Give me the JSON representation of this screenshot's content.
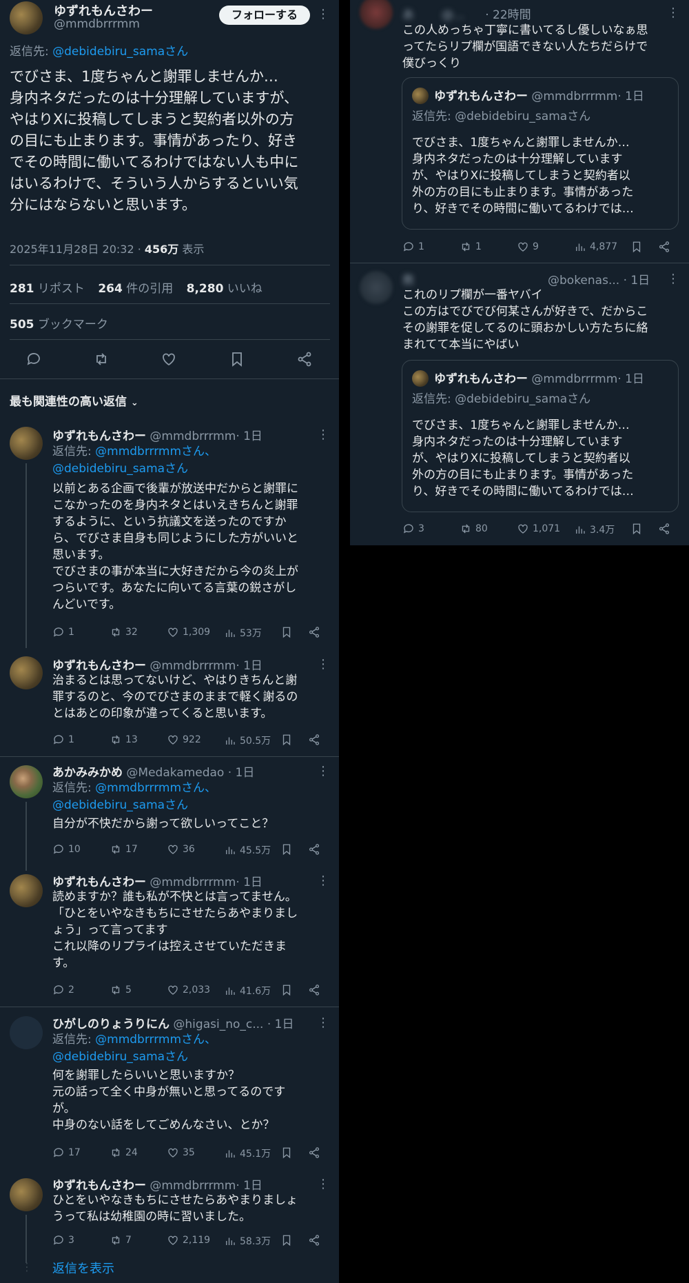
{
  "main": {
    "author": "ゆずれもんさわー",
    "handle": "@mmdbrrrmm",
    "follow_label": "フォローする",
    "reply_prefix": "返信先: ",
    "reply_to": "@debidebiru_samaさん",
    "text": "でびさま、1度ちゃんと謝罪しませんか…\n身内ネタだったのは十分理解していますが、\nやはりXに投稿してしまうと契約者以外の方\nの目にも止まります。事情があったり、好き\nでその時間に働いてるわけではない人も中に\nはいるわけで、そういう人からするといい気\n分にはならないと思います。",
    "date": "2025年11月28日 20:32 · ",
    "views": "456万",
    "views_label": " 表示",
    "reposts": "281",
    "reposts_label": " リポスト",
    "quotes": "264",
    "quotes_label": " 件の引用",
    "likes": "8,280",
    "likes_label": " いいね",
    "bookmarks": "505",
    "bookmarks_label": " ブックマーク"
  },
  "sort_label": "最も関連性の高い返信",
  "show_replies": "返信を表示",
  "replies": [
    {
      "author": "ゆずれもんさわー",
      "handle": "@mmdbrrrmm",
      "time": "· 1日",
      "reply_to_1": "@mmdbrrrmmさん、",
      "reply_to_2": "@debidebiru_samaさん",
      "text": "以前とある企画で後輩が放送中だからと謝罪に\nこなかったのを身内ネタとはいえきちんと謝罪\nするように、という抗議文を送ったのですか\nら、でびさま自身も同じようにした方がいいと\n思います。\nでびさまの事が本当に大好きだから今の炎上が\nつらいです。あなたに向いてる言葉の鋭さがし\nんどいです。",
      "replies": "1",
      "reposts": "32",
      "likes": "1,309",
      "views": "53万"
    },
    {
      "author": "ゆずれもんさわー",
      "handle": "@mmdbrrrmm",
      "time": "· 1日",
      "text": "治まるとは思ってないけど、やはりきちんと謝\n罪するのと、今のでびさまのままで軽く謝るの\nとはあとの印象が違ってくると思います。",
      "replies": "1",
      "reposts": "13",
      "likes": "922",
      "views": "50.5万"
    },
    {
      "author": "あかみみかめ",
      "handle": "@Medakamedao",
      "time": "· 1日",
      "reply_to_1": "@mmdbrrrmmさん、",
      "reply_to_2": "@debidebiru_samaさん",
      "text": "自分が不快だから謝って欲しいってこと？",
      "replies": "10",
      "reposts": "17",
      "likes": "36",
      "views": "45.5万"
    },
    {
      "author": "ゆずれもんさわー",
      "handle": "@mmdbrrrmm",
      "time": "· 1日",
      "text": "読めますか？誰も私が不快とは言ってません。\n「ひとをいやなきもちにさせたらあやまりまし\nょう」って言ってます\nこれ以降のリプライは控えさせていただきま\nす。",
      "replies": "2",
      "reposts": "5",
      "likes": "2,033",
      "views": "41.6万"
    },
    {
      "author": "ひがしのりょうりにん",
      "handle": "@higasi_no_c...",
      "time": "· 1日",
      "reply_to_1": "@mmdbrrrmmさん、",
      "reply_to_2": "@debidebiru_samaさん",
      "text": "何を謝罪したらいいと思いますか？\n元の話って全く中身が無いと思ってるのです\nが。\n中身のない話をしてごめんなさい、とか？",
      "replies": "17",
      "reposts": "24",
      "likes": "35",
      "views": "45.1万"
    },
    {
      "author": "ゆずれもんさわー",
      "handle": "@mmdbrrrmm",
      "time": "· 1日",
      "text": "ひとをいやなきもちにさせたらあやまりましょ\nうって私は幼稚園の時に習いました。",
      "replies": "3",
      "reposts": "7",
      "likes": "2,119",
      "views": "58.3万"
    }
  ],
  "right_posts": [
    {
      "author_blurred": "あ",
      "handle_blurred": "@...",
      "time": "· 22時間",
      "text": "この人めっちゃ丁寧に書いてるし優しいなぁ思\nってたらリプ欄が国語できない人たちだらけで\n僕びっくり",
      "quote": {
        "author": "ゆずれもんさわー",
        "handle": "@mmdbrrrmm",
        "time": "· 1日",
        "reply_prefix": "返信先: ",
        "reply_to": "@debidebiru_samaさん",
        "text": "でびさま、1度ちゃんと謝罪しませんか…\n身内ネタだったのは十分理解しています\nが、やはりXに投稿してしまうと契約者以\n外の方の目にも止まります。事情があった\nり、好きでその時間に働いてるわけでは…"
      },
      "replies": "1",
      "reposts": "1",
      "likes": "9",
      "views": "4,877"
    },
    {
      "author_blurred": "救",
      "handle": "@bokenas...",
      "time": "· 1日",
      "text": "これのリプ欄が一番ヤバイ\nこの方はでびでび何某さんが好きで、だからこ\nその謝罪を促してるのに頭おかしい方たちに絡\nまれてて本当にやばい",
      "quote": {
        "author": "ゆずれもんさわー",
        "handle": "@mmdbrrrmm",
        "time": "· 1日",
        "reply_prefix": "返信先: ",
        "reply_to": "@debidebiru_samaさん",
        "text": "でびさま、1度ちゃんと謝罪しませんか…\n身内ネタだったのは十分理解しています\nが、やはりXに投稿してしまうと契約者以\n外の方の目にも止まります。事情があった\nり、好きでその時間に働いてるわけでは…"
      },
      "replies": "3",
      "reposts": "80",
      "likes": "1,071",
      "views": "3.4万"
    }
  ],
  "colors": {
    "bg": "#15202b",
    "link": "#1d9bf0",
    "muted": "#8b98a5",
    "border": "#38444d"
  }
}
